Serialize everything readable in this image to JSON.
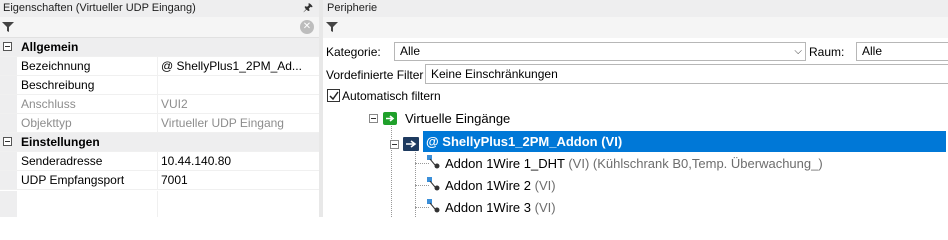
{
  "properties_panel": {
    "title": "Eigenschaften (Virtueller UDP Eingang)",
    "pin_icon": "pin-icon",
    "sections": [
      {
        "title": "Allgemein",
        "rows": [
          {
            "name": "Bezeichnung",
            "value": "@ ShellyPlus1_2PM_Ad...",
            "disabled": false
          },
          {
            "name": "Beschreibung",
            "value": "",
            "disabled": false
          },
          {
            "name": "Anschluss",
            "value": "VUI2",
            "disabled": true
          },
          {
            "name": "Objekttyp",
            "value": "Virtueller UDP Eingang",
            "disabled": true
          }
        ]
      },
      {
        "title": "Einstellungen",
        "rows": [
          {
            "name": "Senderadresse",
            "value": "10.44.140.80",
            "disabled": false
          },
          {
            "name": "UDP Empfangsport",
            "value": "7001",
            "disabled": false
          }
        ]
      }
    ]
  },
  "periphery_panel": {
    "title": "Peripherie",
    "kategorie_label": "Kategorie:",
    "kategorie_value": "Alle",
    "raum_label": "Raum:",
    "raum_value": "Alle",
    "vordefinierte_label": "Vordefinierte Filter",
    "vordefinierte_value": "Keine Einschränkungen",
    "auto_filter_label": "Automatisch filtern",
    "auto_filter_checked": true,
    "tree": {
      "group_label": "Virtuelle Eingänge",
      "selected_label": "@ ShellyPlus1_2PM_Addon  (VI)",
      "children": [
        {
          "label": "Addon 1Wire 1_DHT",
          "suffix": "(VI)  (Kühlschrank B0,Temp. Überwachung_)"
        },
        {
          "label": "Addon 1Wire 2",
          "suffix": "(VI)"
        },
        {
          "label": "Addon 1Wire 3",
          "suffix": "(VI)"
        }
      ]
    }
  },
  "colors": {
    "selection": "#0078d7",
    "group_icon": "#1fa02a",
    "input_icon_blue": "#3b8fd9"
  }
}
